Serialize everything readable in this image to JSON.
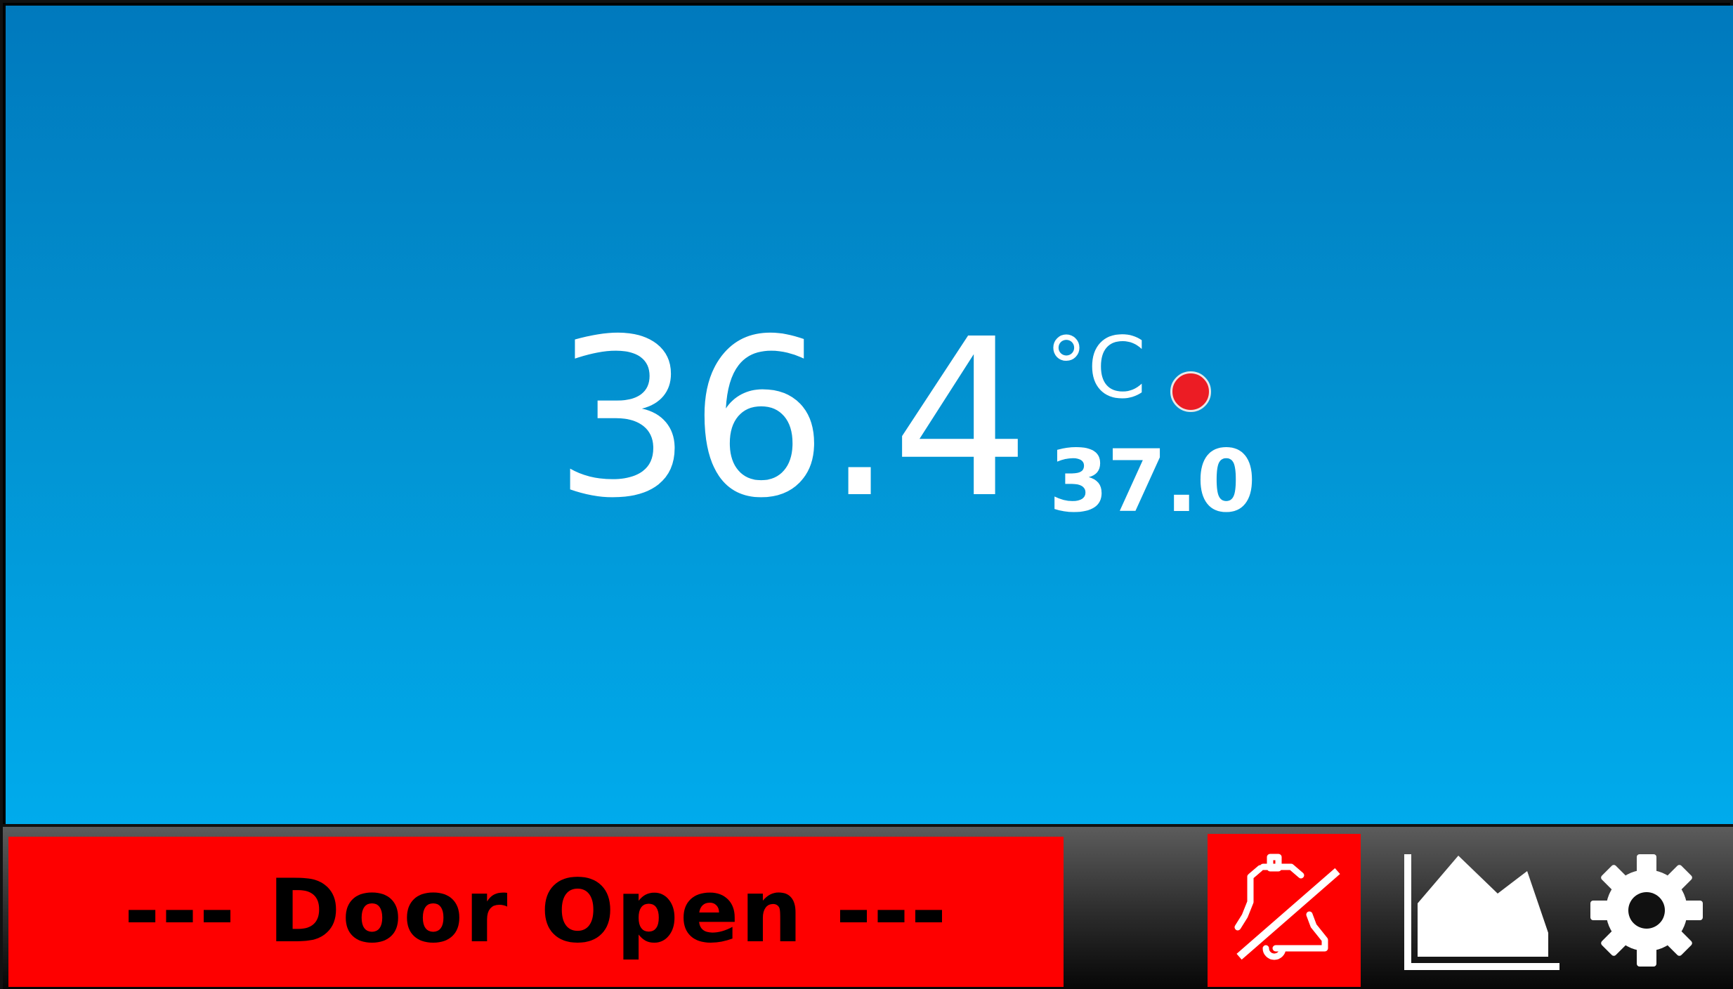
{
  "display": {
    "current_temperature": "36.4",
    "unit": "°C",
    "setpoint": "37.0",
    "status_indicator": {
      "icon": "status-dot",
      "color": "#ec1c24"
    }
  },
  "status_bar": {
    "alarm_message": "--- Door Open ---",
    "alarm_color": "#fe0000",
    "buttons": [
      {
        "name": "alarm-mute",
        "icon": "bell-slash-icon"
      },
      {
        "name": "chart",
        "icon": "area-chart-icon"
      },
      {
        "name": "settings",
        "icon": "gear-icon"
      }
    ]
  }
}
